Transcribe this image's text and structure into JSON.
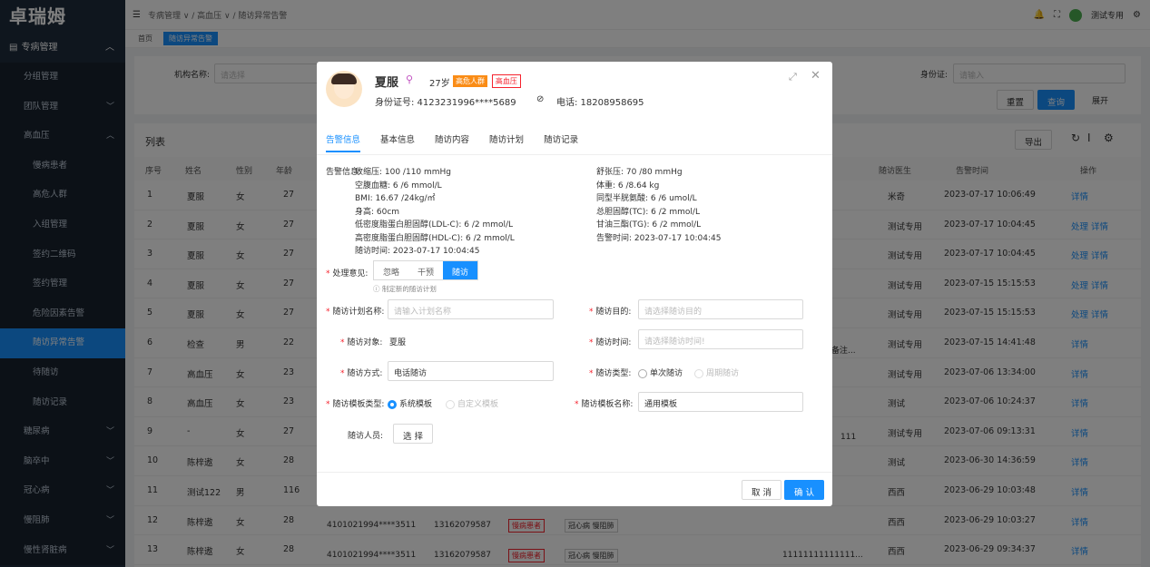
{
  "app": {
    "logo": "卓瑞姆",
    "menu_top": "专病管理"
  },
  "sidebar": [
    "分组管理",
    "团队管理",
    "高血压",
    "慢病患者",
    "高危人群",
    "入组管理",
    "签约二维码",
    "签约管理",
    "危险因素告警",
    "随访异常告警",
    "待随访",
    "随访记录",
    "糖尿病",
    "脑卒中",
    "冠心病",
    "慢阻肺",
    "慢性肾脏病"
  ],
  "topbar": {
    "breadcrumb": "专病管理 ∨ / 高血压 ∨ / 随访异常告警",
    "user": "测试专用"
  },
  "tabs": [
    "首页",
    "随访异常告警"
  ],
  "filter": {
    "org_label": "机构名称:",
    "org_ph": "请选择",
    "id_label": "身份证:",
    "id_ph": "请输入",
    "reset": "重置",
    "search": "查询",
    "expand": "展开"
  },
  "list": {
    "title": "列表",
    "export": "导出",
    "headers": [
      "序号",
      "姓名",
      "性别",
      "年龄",
      "随访医生",
      "告警时间",
      "操作"
    ],
    "rows": [
      {
        "no": "1",
        "name": "夏服",
        "sex": "女",
        "age": "27",
        "doc": "米奇",
        "time": "2023-07-17 10:06:49",
        "ops": "详情"
      },
      {
        "no": "2",
        "name": "夏服",
        "sex": "女",
        "age": "27",
        "doc": "测试专用",
        "time": "2023-07-17 10:04:45",
        "ops": "处理 详情"
      },
      {
        "no": "3",
        "name": "夏服",
        "sex": "女",
        "age": "27",
        "doc": "测试专用",
        "time": "2023-07-17 10:04:45",
        "ops": "处理 详情"
      },
      {
        "no": "4",
        "name": "夏服",
        "sex": "女",
        "age": "27",
        "doc": "测试专用",
        "time": "2023-07-15 15:15:53",
        "ops": "处理 详情"
      },
      {
        "no": "5",
        "name": "夏服",
        "sex": "女",
        "age": "27",
        "doc": "测试专用",
        "time": "2023-07-15 15:15:53",
        "ops": "处理 详情"
      },
      {
        "no": "6",
        "name": "检查",
        "sex": "男",
        "age": "22",
        "doc": "测试专用",
        "time": "2023-07-15 14:41:48",
        "ops": "详情"
      },
      {
        "no": "7",
        "name": "高血压",
        "sex": "女",
        "age": "23",
        "doc": "测试专用",
        "time": "2023-07-06 13:34:00",
        "ops": "详情"
      },
      {
        "no": "8",
        "name": "高血压",
        "sex": "女",
        "age": "23",
        "doc": "测试",
        "time": "2023-07-06 10:24:37",
        "ops": "详情"
      },
      {
        "no": "9",
        "name": "-",
        "sex": "女",
        "age": "27",
        "doc": "测试专用",
        "time": "2023-07-06 09:13:31",
        "ops": "详情"
      },
      {
        "no": "10",
        "name": "陈梓遨",
        "sex": "女",
        "age": "28",
        "doc": "测试",
        "time": "2023-06-30 14:36:59",
        "ops": "详情"
      },
      {
        "no": "11",
        "name": "测试122",
        "sex": "男",
        "age": "116",
        "doc": "西西",
        "time": "2023-06-29 10:03:48",
        "ops": "详情"
      },
      {
        "no": "12",
        "name": "陈梓遨",
        "sex": "女",
        "age": "28",
        "doc": "西西",
        "time": "2023-06-29 10:03:27",
        "ops": "详情"
      },
      {
        "no": "13",
        "name": "陈梓遨",
        "sex": "女",
        "age": "28",
        "doc": "西西",
        "time": "2023-06-29 09:34:37",
        "ops": "详情"
      }
    ],
    "extra": {
      "id12": "4101021994****3511",
      "phone12": "13162079587",
      "tag12": "慢病患者",
      "tags12": "冠心病 慢阻肺",
      "id13": "4101021994****3511",
      "phone13": "13162079587",
      "tag13": "慢病患者",
      "tags13": "冠心病 慢阻肺",
      "row6col": "备注...",
      "row9col": "111",
      "row13col": "11111111111111..."
    }
  },
  "dialog": {
    "name": "夏服",
    "age": "27岁",
    "badge1": "高危人群",
    "badge2": "高血压",
    "id": "身份证号:  4123231996****5689",
    "phone": "电话:  18208958695",
    "tabs": [
      "告警信息",
      "基本信息",
      "随访内容",
      "随访计划",
      "随访记录"
    ],
    "alert_label": "告警信息:",
    "left": [
      "收缩压: 100 /110 mmHg",
      "空腹血糖: 6 /6 mmol/L",
      "BMI: 16.67 /24kg/㎡",
      "身高: 60cm",
      "低密度脂蛋白胆固醇(LDL-C): 6 /2 mmol/L",
      "高密度脂蛋白胆固醇(HDL-C): 6 /2 mmol/L",
      "随访时间: 2023-07-17 10:04:45"
    ],
    "right": [
      "舒张压: 70 /80 mmHg",
      "体重: 6 /8.64 kg",
      "同型半胱氨酸: 6 /6 umol/L",
      "总胆固醇(TC): 6 /2 mmol/L",
      "甘油三酯(TG): 6 /2 mmol/L",
      "告警时间: 2023-07-17 10:04:45"
    ],
    "opinion_label": "处理意见:",
    "opinions": [
      "忽略",
      "干预",
      "随访"
    ],
    "hint": "ⓘ 制定新的随访计划",
    "plan_label": "随访计划名称:",
    "plan_ph": "请输入计划名称",
    "purpose_label": "随访目的:",
    "purpose_ph": "请选择随访目的",
    "target_label": "随访对象:",
    "target": "夏服",
    "time_label": "随访时间:",
    "time_ph": "请选择随访时间!",
    "method_label": "随访方式:",
    "method": "电话随访",
    "type_label": "随访类型:",
    "type1": "单次随访",
    "type2": "周期随访",
    "tpl_type_label": "随访模板类型:",
    "tpl1": "系统模板",
    "tpl2": "自定义模板",
    "tpl_name_label": "随访模板名称:",
    "tpl_name": "通用模板",
    "staff_label": "随访人员:",
    "choose": "选 择",
    "cancel": "取 消",
    "ok": "确 认"
  }
}
